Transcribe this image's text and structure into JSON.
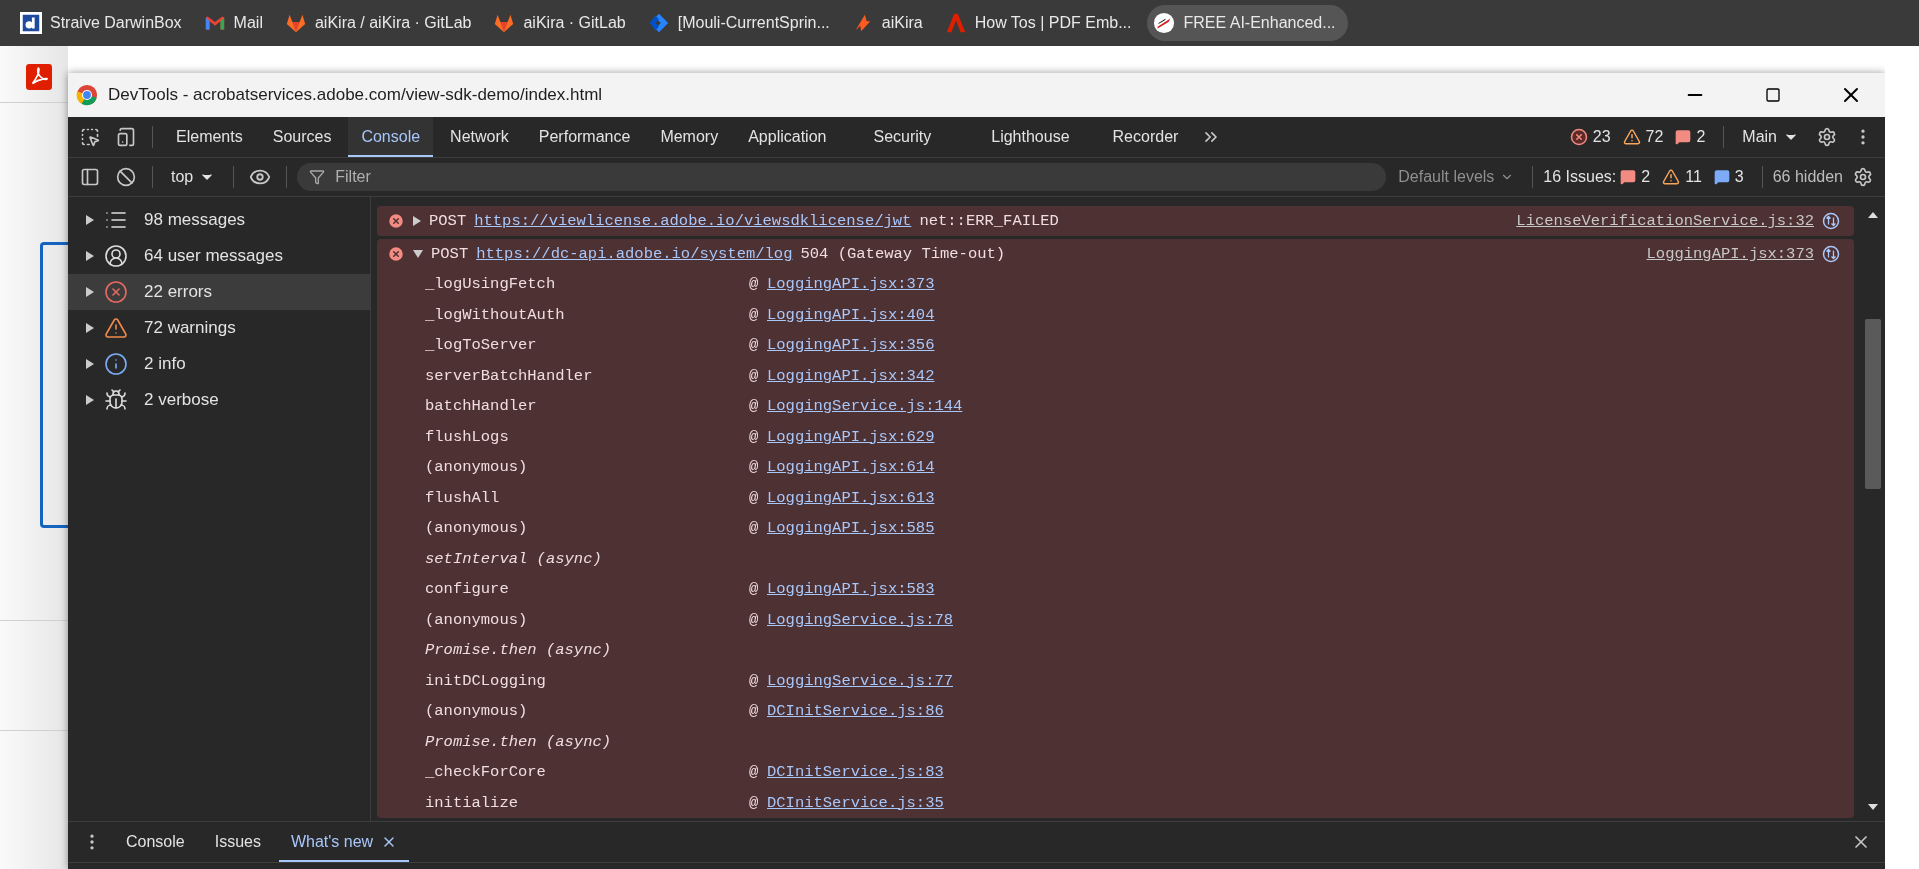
{
  "bookmarks": [
    {
      "label": "Straive DarwinBox",
      "highlighted": false
    },
    {
      "label": "Mail",
      "highlighted": false
    },
    {
      "label": "aiKira / aiKira · GitLab",
      "highlighted": false
    },
    {
      "label": "aiKira · GitLab",
      "highlighted": false
    },
    {
      "label": "[Mouli-CurrentSprin...",
      "highlighted": false
    },
    {
      "label": "aiKira",
      "highlighted": false
    },
    {
      "label": "How Tos | PDF Emb...",
      "highlighted": false
    },
    {
      "label": "FREE AI-Enhanced...",
      "highlighted": true
    }
  ],
  "window": {
    "title": "DevTools - acrobatservices.adobe.com/view-sdk-demo/index.html"
  },
  "tabs": [
    {
      "label": "Elements",
      "selected": false
    },
    {
      "label": "Sources",
      "selected": false
    },
    {
      "label": "Console",
      "selected": true
    },
    {
      "label": "Network",
      "selected": false
    },
    {
      "label": "Performance",
      "selected": false
    },
    {
      "label": "Memory",
      "selected": false
    },
    {
      "label": "Application",
      "selected": false
    },
    {
      "label": "Security",
      "selected": false
    },
    {
      "label": "Lighthouse",
      "selected": false
    },
    {
      "label": "Recorder",
      "selected": false
    }
  ],
  "counters": [
    {
      "kind": "error",
      "count": "23"
    },
    {
      "kind": "warning",
      "count": "72"
    },
    {
      "kind": "issue",
      "count": "2"
    }
  ],
  "target": "Main",
  "console_toolbar": {
    "context": "top",
    "filter": {
      "placeholder": "Filter"
    },
    "levels": "Default levels",
    "issues_label": "16 Issues:",
    "issues": [
      {
        "kind": "issue",
        "count": "2"
      },
      {
        "kind": "warning",
        "count": "11"
      },
      {
        "kind": "info",
        "count": "3"
      }
    ],
    "hidden": "66 hidden"
  },
  "sidebar": {
    "items": [
      {
        "label": "98 messages",
        "selected": false
      },
      {
        "label": "64 user messages",
        "selected": false
      },
      {
        "label": "22 errors",
        "selected": true
      },
      {
        "label": "72 warnings",
        "selected": false
      },
      {
        "label": "2 info",
        "selected": false
      },
      {
        "label": "2 verbose",
        "selected": false
      }
    ]
  },
  "messages": [
    {
      "kind": "error",
      "expanded": false,
      "method": "POST",
      "url": "https://viewlicense.adobe.io/viewsdklicense/jwt",
      "detail": "net::ERR_FAILED",
      "source": "LicenseVerificationService.js:32"
    },
    {
      "kind": "error",
      "expanded": true,
      "method": "POST",
      "url": "https://dc-api.adobe.io/system/log",
      "detail": "504 (Gateway Time-out)",
      "source": "LoggingAPI.jsx:373",
      "stack": [
        {
          "kind": "frame",
          "function": "_logUsingFetch",
          "at": "@",
          "link": "LoggingAPI.jsx:373"
        },
        {
          "kind": "frame",
          "function": "_logWithoutAuth",
          "at": "@",
          "link": "LoggingAPI.jsx:404"
        },
        {
          "kind": "frame",
          "function": "_logToServer",
          "at": "@",
          "link": "LoggingAPI.jsx:356"
        },
        {
          "kind": "frame",
          "function": "serverBatchHandler",
          "at": "@",
          "link": "LoggingAPI.jsx:342"
        },
        {
          "kind": "frame",
          "function": "batchHandler",
          "at": "@",
          "link": "LoggingService.js:144"
        },
        {
          "kind": "frame",
          "function": "flushLogs",
          "at": "@",
          "link": "LoggingAPI.jsx:629"
        },
        {
          "kind": "frame",
          "function": "(anonymous)",
          "at": "@",
          "link": "LoggingAPI.jsx:614"
        },
        {
          "kind": "frame",
          "function": "flushAll",
          "at": "@",
          "link": "LoggingAPI.jsx:613"
        },
        {
          "kind": "frame",
          "function": "(anonymous)",
          "at": "@",
          "link": "LoggingAPI.jsx:585"
        },
        {
          "kind": "async",
          "function": "setInterval (async)"
        },
        {
          "kind": "frame",
          "function": "configure",
          "at": "@",
          "link": "LoggingAPI.jsx:583"
        },
        {
          "kind": "frame",
          "function": "(anonymous)",
          "at": "@",
          "link": "LoggingService.js:78"
        },
        {
          "kind": "async",
          "function": "Promise.then (async)"
        },
        {
          "kind": "frame",
          "function": "initDCLogging",
          "at": "@",
          "link": "LoggingService.js:77"
        },
        {
          "kind": "frame",
          "function": "(anonymous)",
          "at": "@",
          "link": "DCInitService.js:86"
        },
        {
          "kind": "async",
          "function": "Promise.then (async)"
        },
        {
          "kind": "frame",
          "function": "_checkForCore",
          "at": "@",
          "link": "DCInitService.js:83"
        },
        {
          "kind": "frame",
          "function": "initialize",
          "at": "@",
          "link": "DCInitService.js:35"
        }
      ]
    }
  ],
  "drawer": {
    "tabs": [
      {
        "label": "Console",
        "selected": false
      },
      {
        "label": "Issues",
        "selected": false
      },
      {
        "label": "What's new",
        "selected": true
      }
    ]
  }
}
